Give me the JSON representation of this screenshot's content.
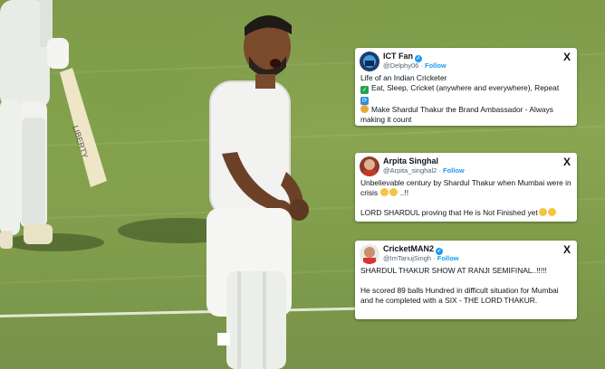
{
  "tweets": [
    {
      "display_name": "ICT Fan",
      "handle": "@Delphy06",
      "follow_label": "Follow",
      "x_icon": "X",
      "verified": true,
      "lines": [
        "Life of an Indian Cricketer",
        "Eat, Sleep, Cricket (anywhere and everywhere), Repeat",
        "Make Shardul Thakur the Brand Ambassador - Always making it count"
      ]
    },
    {
      "display_name": "Arpita Singhal",
      "handle": "@Arpita_singhal2",
      "follow_label": "Follow",
      "x_icon": "X",
      "verified": false,
      "lines": [
        "Unbelievable century by Shardul Thakur when Mumbai were in crisis",
        "..!!",
        "LORD SHARDUL proving that He is Not Finished yet"
      ]
    },
    {
      "display_name": "CricketMAN2",
      "handle": "@ImTanujSingh",
      "follow_label": "Follow",
      "x_icon": "X",
      "verified": true,
      "lines": [
        "SHARDUL THAKUR SHOW AT RANJI SEMIFINAL..!!!!!",
        "He scored 89 balls Hundred in difficult situation for Mumbai and he completed with a SIX - THE LORD THAKUR."
      ]
    }
  ],
  "icons": [
    "verified-badge-icon",
    "x-logo-icon",
    "check-mark-emoji",
    "repeat-emoji",
    "medal-emoji",
    "face-emoji"
  ],
  "colors": {
    "link": "#1d9bf0",
    "text": "#0f1419",
    "muted": "#536471"
  }
}
